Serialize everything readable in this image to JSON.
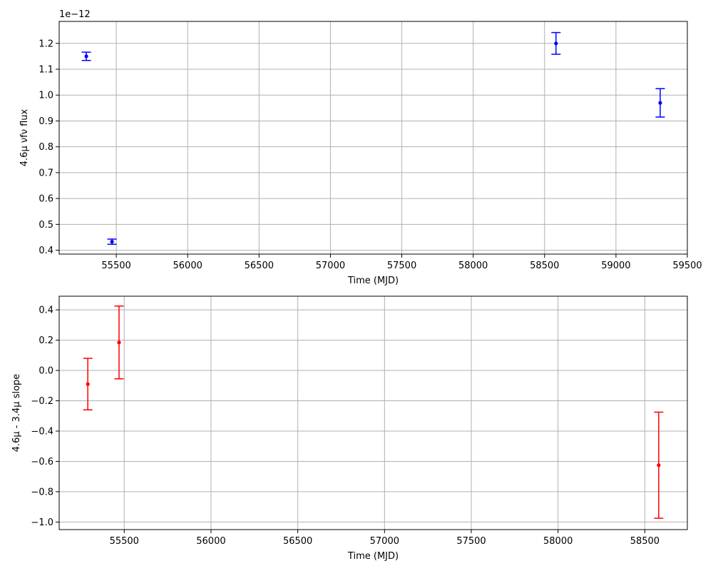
{
  "chart_data": [
    {
      "type": "scatter",
      "title": "",
      "xlabel": "Time (MJD)",
      "ylabel": "4.6μ νfν flux",
      "y_offset_label": "1e−12",
      "xlim": [
        55100,
        59500
      ],
      "ylim": [
        0.385,
        1.285
      ],
      "x_ticks": [
        55500,
        56000,
        56500,
        57000,
        57500,
        58000,
        58500,
        59000,
        59500
      ],
      "y_ticks": [
        0.4,
        0.5,
        0.6,
        0.7,
        0.8,
        0.9,
        1.0,
        1.1,
        1.2
      ],
      "grid": true,
      "legend": "none",
      "series": [
        {
          "color": "#0000ff",
          "marker": "point",
          "x": [
            55290,
            55470,
            58580,
            59310
          ],
          "y": [
            1.15,
            0.433,
            1.2,
            0.97
          ],
          "yerr": [
            0.016,
            0.01,
            0.042,
            0.055
          ]
        }
      ]
    },
    {
      "type": "scatter",
      "title": "",
      "xlabel": "Time (MJD)",
      "ylabel": "4.6μ - 3.4μ slope",
      "xlim": [
        55125,
        58745
      ],
      "ylim": [
        -1.05,
        0.49
      ],
      "x_ticks": [
        55500,
        56000,
        56500,
        57000,
        57500,
        58000,
        58500
      ],
      "y_ticks": [
        -1.0,
        -0.8,
        -0.6,
        -0.4,
        -0.2,
        0.0,
        0.2,
        0.4
      ],
      "grid": true,
      "legend": "none",
      "series": [
        {
          "color": "#ff0000",
          "marker": "point",
          "x": [
            55290,
            55470,
            58580
          ],
          "y": [
            -0.09,
            0.185,
            -0.625
          ],
          "yerr": [
            0.17,
            0.24,
            0.35
          ]
        }
      ]
    }
  ]
}
